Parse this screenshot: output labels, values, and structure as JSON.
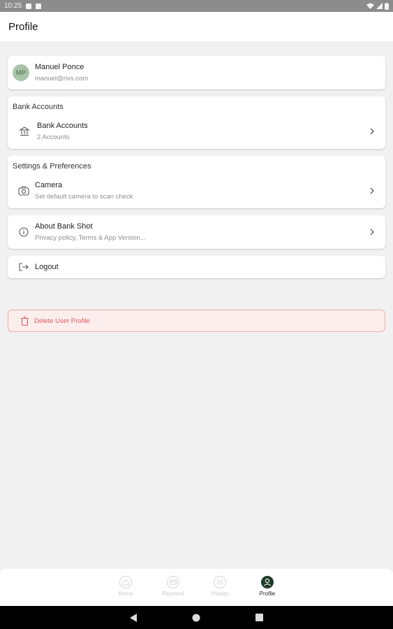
{
  "status_bar": {
    "time": "10:25"
  },
  "app_bar": {
    "title": "Profile"
  },
  "profile": {
    "initials": "MP",
    "name": "Manuel Ponce",
    "email": "manuel@rivs.com"
  },
  "bank_section": {
    "title": "Bank Accounts",
    "item": {
      "label": "Bank Accounts",
      "sub": "2 Accounts"
    }
  },
  "settings_section": {
    "title": "Settings & Preferences",
    "item": {
      "label": "Camera",
      "sub": "Set default camera to scan check"
    }
  },
  "about": {
    "label": "About Bank Shot",
    "sub": "Privacy policy, Terms & App Version..."
  },
  "logout": {
    "label": "Logout"
  },
  "delete": {
    "label": "Delete User Profile"
  },
  "bottom_nav": {
    "items": [
      {
        "label": "Home",
        "icon": "home-icon"
      },
      {
        "label": "Payment",
        "icon": "payment-icon"
      },
      {
        "label": "History",
        "icon": "history-icon"
      },
      {
        "label": "Profile",
        "icon": "profile-icon"
      }
    ],
    "active": "Profile"
  },
  "colors": {
    "accent_dark": "#1f3b2a",
    "danger": "#e0585a",
    "avatar_bg": "#a9c4a9"
  }
}
